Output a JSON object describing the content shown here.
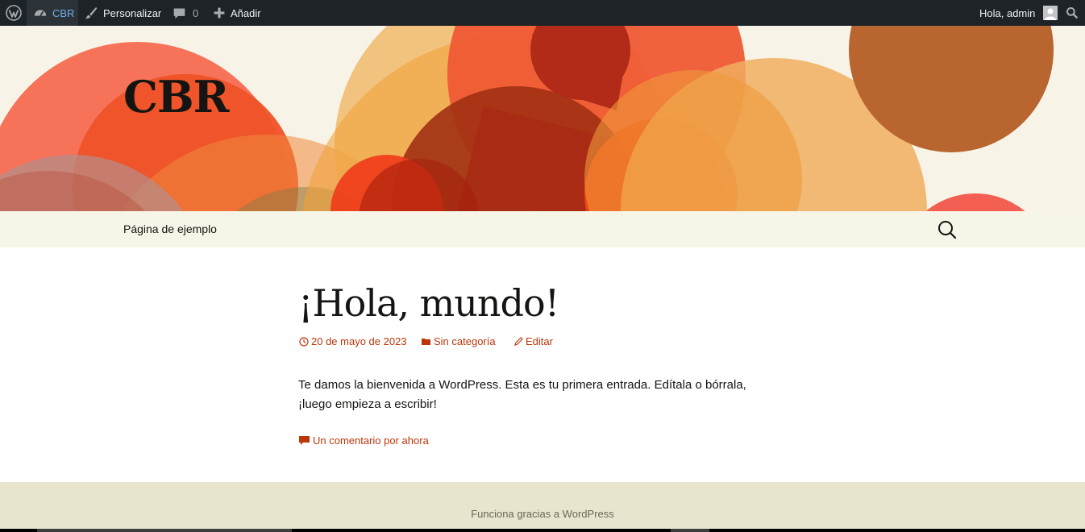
{
  "adminbar": {
    "site_name": "CBR",
    "customize_label": "Personalizar",
    "comments_count": "0",
    "new_label": "Añadir",
    "greeting": "Hola, admin"
  },
  "header": {
    "site_title": "CBR"
  },
  "nav": {
    "items": [
      {
        "label": "Página de ejemplo"
      }
    ]
  },
  "post": {
    "title": "¡Hola, mundo!",
    "date": "20 de mayo de 2023",
    "category": "Sin categoría",
    "edit_label": "Editar",
    "content": "Te damos la bienvenida a WordPress. Esta es tu primera entrada. Edítala o bórrala, ¡luego empieza a escribir!",
    "comments_link": "Un comentario por ahora"
  },
  "footer": {
    "credit": "Funciona gracias a WordPress"
  },
  "colors": {
    "adminbar_bg": "#1d2327",
    "accent_link": "#bc360a",
    "header_bg": "#f7f4e7",
    "footer_bg": "#e8e5ce"
  },
  "icons": [
    "wordpress-logo-icon",
    "dashboard-icon",
    "brush-icon",
    "comment-bubble-icon",
    "plus-icon",
    "avatar-icon",
    "search-icon",
    "clock-icon",
    "folder-icon",
    "pencil-icon"
  ]
}
